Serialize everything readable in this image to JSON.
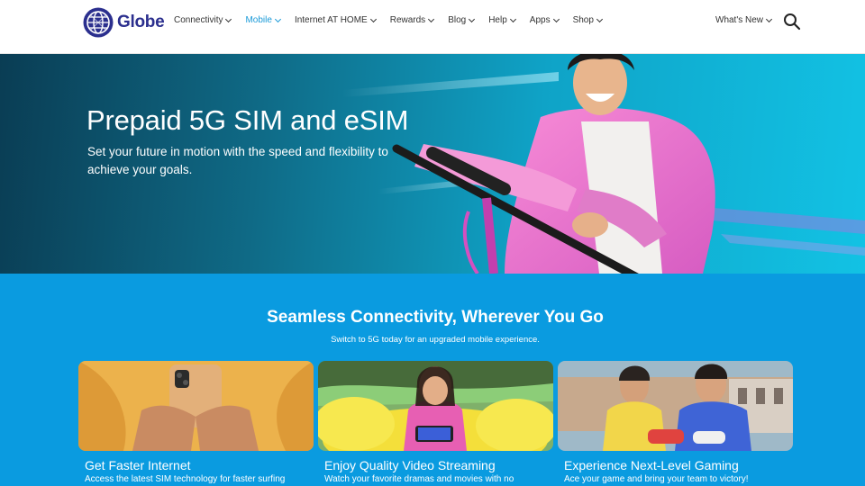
{
  "brand": {
    "name": "Globe"
  },
  "nav": {
    "items": [
      {
        "label": "Connectivity"
      },
      {
        "label": "Mobile"
      },
      {
        "label": "Internet AT HOME"
      },
      {
        "label": "Rewards"
      },
      {
        "label": "Blog"
      },
      {
        "label": "Help"
      },
      {
        "label": "Apps"
      },
      {
        "label": "Shop"
      }
    ],
    "active_item": "Mobile",
    "whats_new": "What's New",
    "search_icon": "search-icon"
  },
  "hero": {
    "title": "Prepaid 5G SIM and eSIM",
    "subtitle": "Set your future in motion with the speed and flexibility to achieve your goals."
  },
  "section": {
    "title": "Seamless Connectivity, Wherever You Go",
    "subtitle": "Switch to 5G today for an upgraded mobile experience."
  },
  "cards": [
    {
      "title": "Get Faster Internet",
      "desc": "Access the latest SIM technology for faster surfing"
    },
    {
      "title": "Enjoy Quality Video Streaming",
      "desc": "Watch your favorite dramas and movies with no"
    },
    {
      "title": "Experience Next-Level Gaming",
      "desc": "Ace your game and bring your team to victory!"
    }
  ],
  "colors": {
    "accent": "#1a9ad8",
    "brand": "#2b2f8e",
    "section_bg": "#0a9be0"
  }
}
